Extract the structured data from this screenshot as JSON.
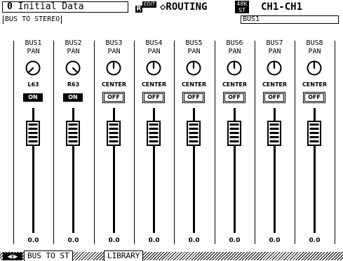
{
  "title_bar": {
    "scene_number": "0",
    "scene_name": "Initial Data",
    "badge_r": "R",
    "badge_edit": "EDIT",
    "screen_title": "◇ROUTING",
    "fs_top": "48K",
    "fs_bottom": "ST",
    "channel_range": "CH1-CH1"
  },
  "section": {
    "left_label": "BUS TO STEREO",
    "right_label": "BUS1"
  },
  "strips": [
    {
      "name": "BUS1",
      "pan_label": "PAN",
      "pan_value": "L63",
      "pan_angle": -135,
      "onoff": "ON",
      "fader_value": "0.0"
    },
    {
      "name": "BUS2",
      "pan_label": "PAN",
      "pan_value": "R63",
      "pan_angle": 135,
      "onoff": "ON",
      "fader_value": "0.0"
    },
    {
      "name": "BUS3",
      "pan_label": "PAN",
      "pan_value": "CENTER",
      "pan_angle": 0,
      "onoff": "OFF",
      "fader_value": "0.0"
    },
    {
      "name": "BUS4",
      "pan_label": "PAN",
      "pan_value": "CENTER",
      "pan_angle": 0,
      "onoff": "OFF",
      "fader_value": "0.0"
    },
    {
      "name": "BUS5",
      "pan_label": "PAN",
      "pan_value": "CENTER",
      "pan_angle": 0,
      "onoff": "OFF",
      "fader_value": "0.0"
    },
    {
      "name": "BUS6",
      "pan_label": "PAN",
      "pan_value": "CENTER",
      "pan_angle": 0,
      "onoff": "OFF",
      "fader_value": "0.0"
    },
    {
      "name": "BUS7",
      "pan_label": "PAN",
      "pan_value": "CENTER",
      "pan_angle": 0,
      "onoff": "OFF",
      "fader_value": "0.0"
    },
    {
      "name": "BUS8",
      "pan_label": "PAN",
      "pan_value": "CENTER",
      "pan_angle": 0,
      "onoff": "OFF",
      "fader_value": "0.0"
    }
  ],
  "tabs": {
    "nav_arrows": "◀I▶",
    "items": [
      {
        "label": "BUS TO ST",
        "active": true
      },
      {
        "label": "LIBRARY",
        "active": false
      }
    ]
  },
  "colors": {
    "foreground": "#000000",
    "background": "#ffffff"
  }
}
